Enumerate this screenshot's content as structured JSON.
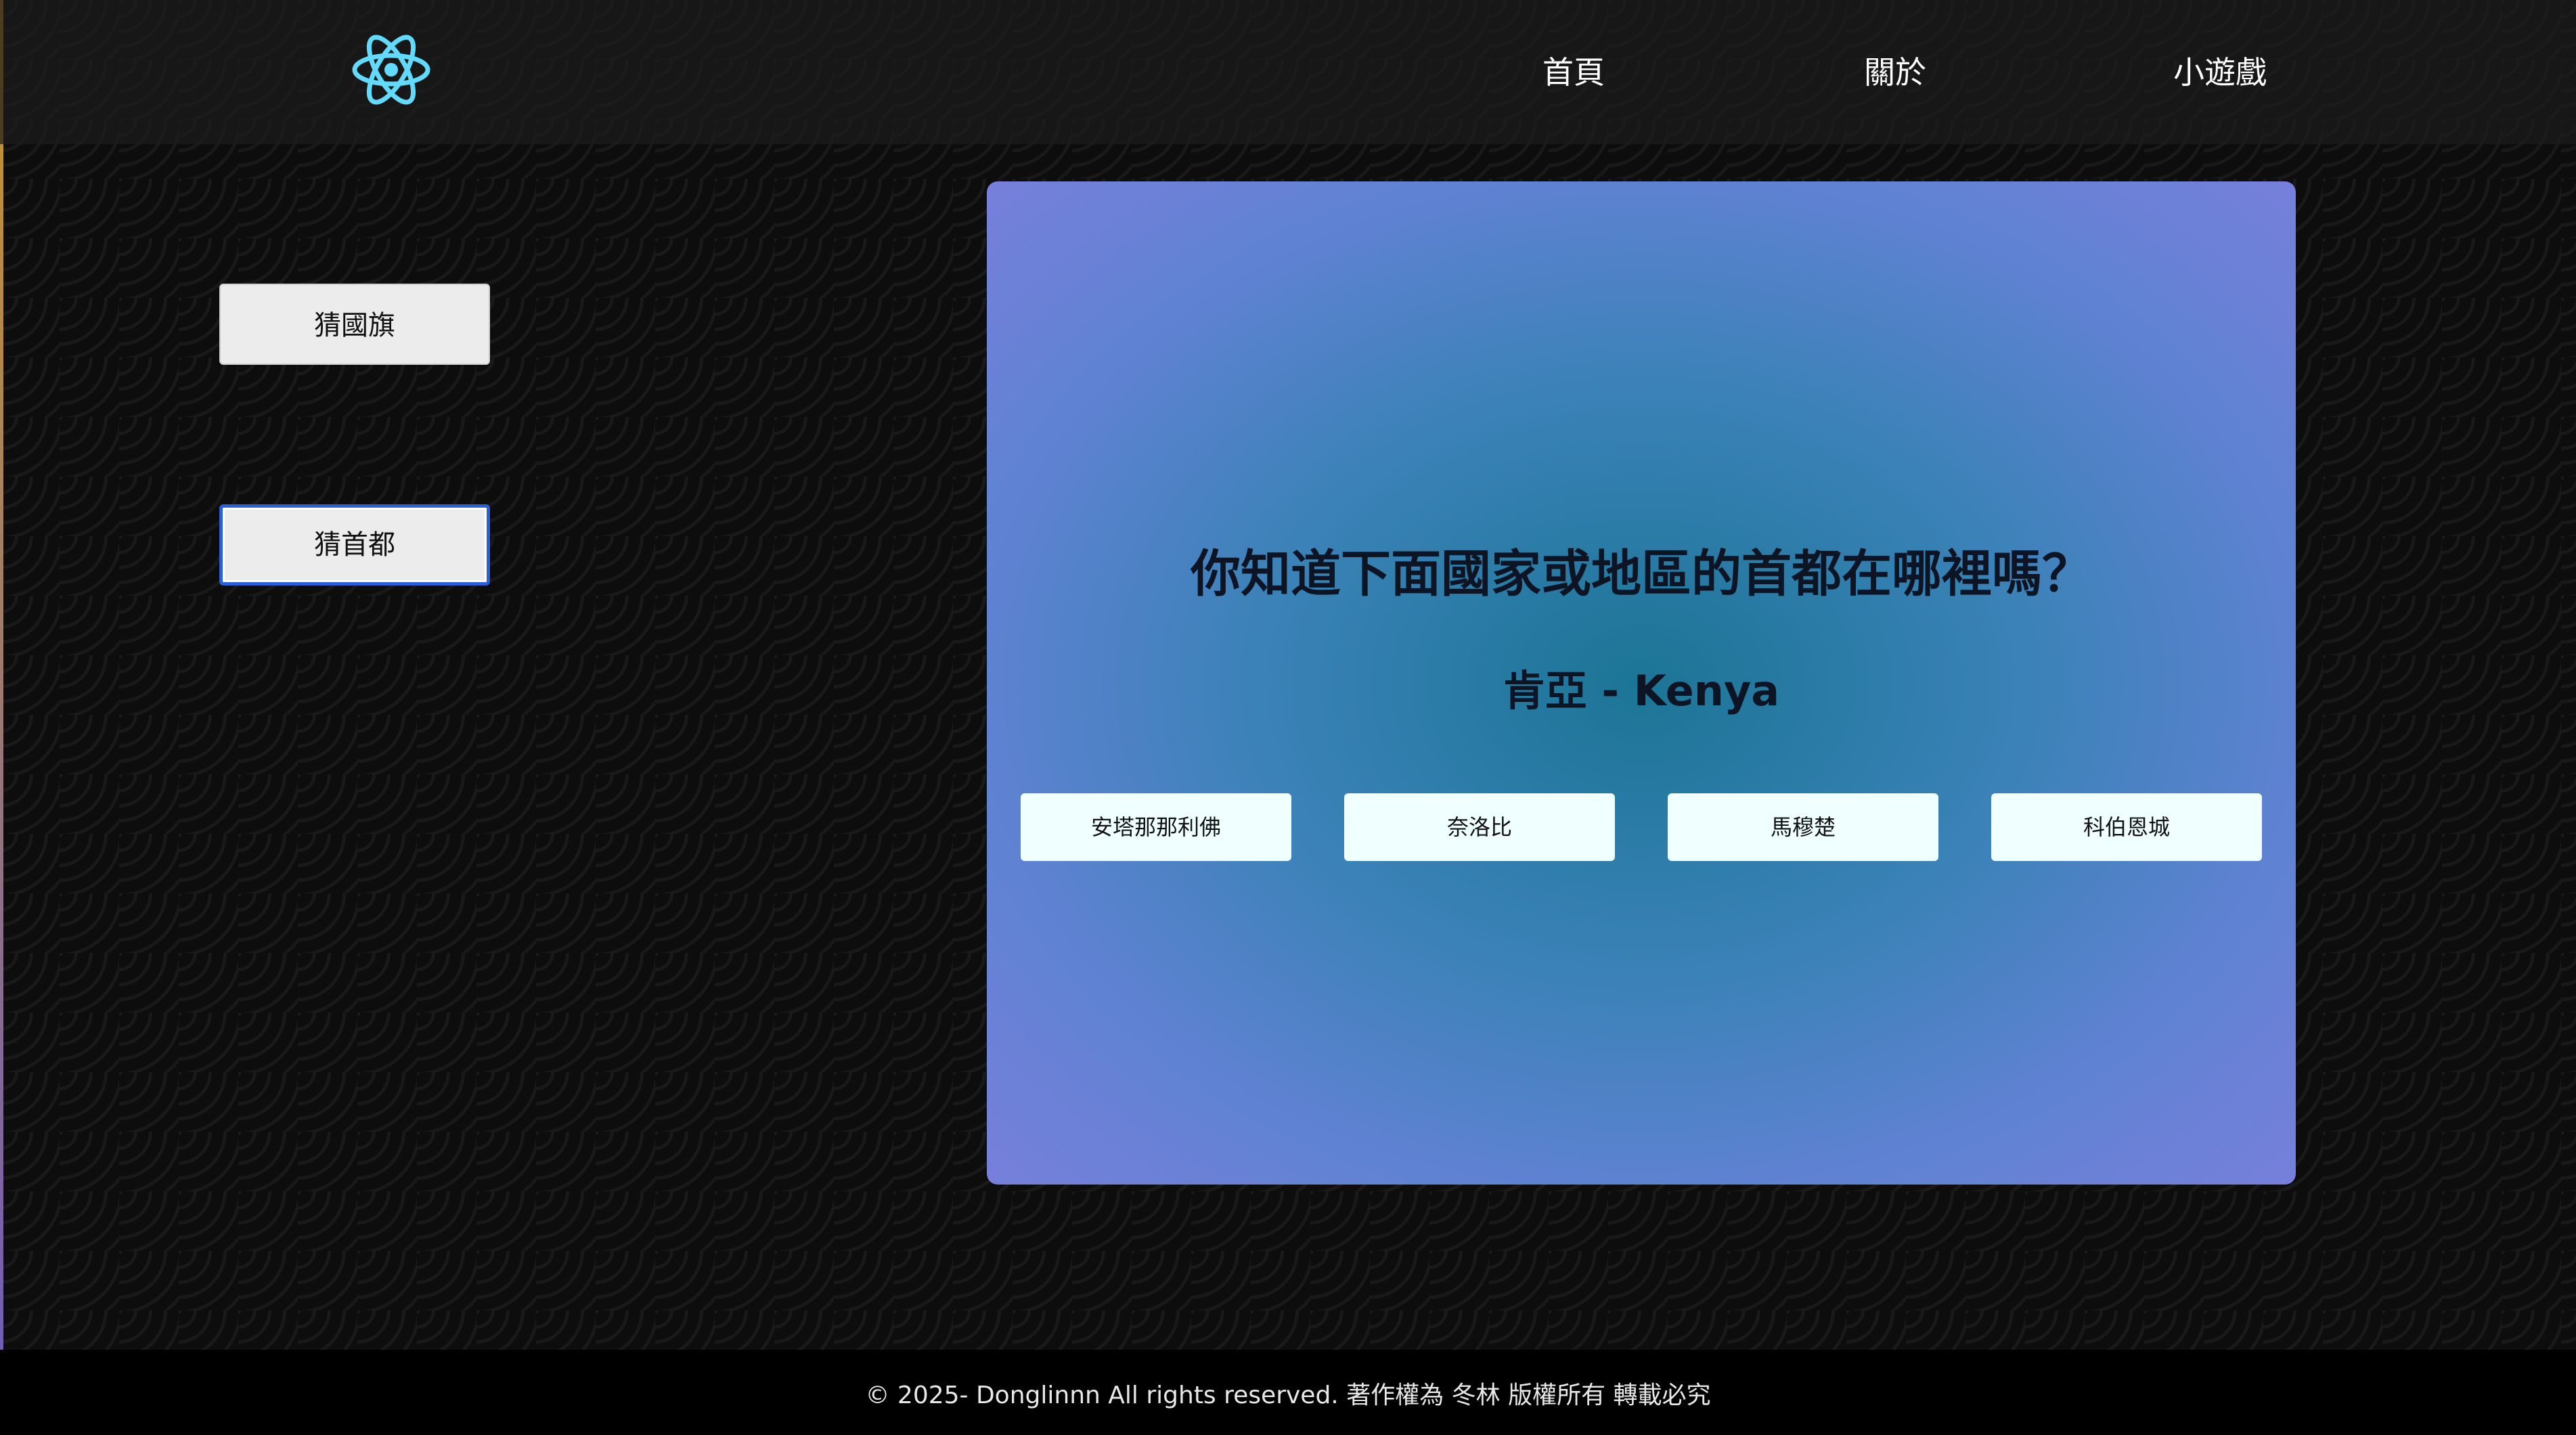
{
  "header": {
    "logo_icon": "react-atom-icon",
    "nav": {
      "home": "首頁",
      "about": "關於",
      "games": "小遊戲"
    }
  },
  "sidebar": {
    "guess_flag": "猜國旗",
    "guess_capital": "猜首都"
  },
  "quiz": {
    "question": "你知道下面國家或地區的首都在哪裡嗎？",
    "country": "肯亞 - Kenya",
    "options": [
      "安塔那那利佛",
      "奈洛比",
      "馬穆楚",
      "科伯恩城"
    ]
  },
  "footer": {
    "copyright": "© 2025- Donglinnn All rights reserved. 著作權為 冬林 版權所有 轉載必究"
  },
  "colors": {
    "accent_logo": "#61dafb",
    "active_outline": "#2b5fd9",
    "panel_center": "#1b7596",
    "panel_edge": "#7780dc",
    "option_bg": "#f0ffff"
  }
}
